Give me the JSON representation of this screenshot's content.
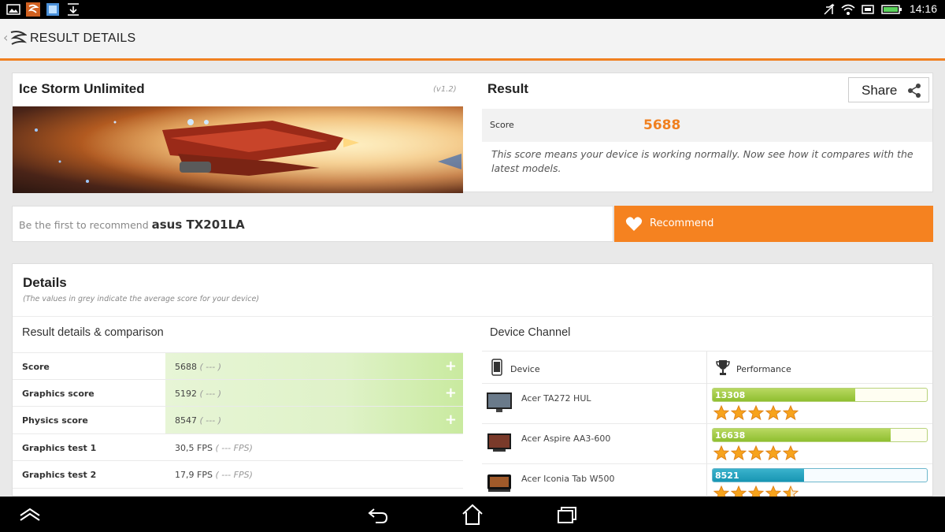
{
  "status_bar": {
    "time": "14:16",
    "left_icons": [
      "gallery-icon",
      "app-icon",
      "screenshot-icon",
      "download-icon"
    ],
    "right_icons": [
      "mute-icon",
      "wifi-icon",
      "cast-icon",
      "battery-icon"
    ],
    "colors": {
      "background": "#000000",
      "text": "#ffffff"
    }
  },
  "app_bar": {
    "title": "RESULT DETAILS",
    "back_icon": "chevron-left-icon",
    "logo_icon": "futuremark-logo-icon",
    "accent": "#f08020"
  },
  "benchmark": {
    "test_name": "Ice Storm Unlimited",
    "version": "(v1.2)",
    "banner": "spaceship-banner-image"
  },
  "result": {
    "title": "Result",
    "share_label": "Share",
    "share_icon": "share-icon",
    "score_label": "Score",
    "score_value": "5688",
    "message": "This score means your device is working normally. Now see how it compares with the latest models.",
    "score_color": "#f08020"
  },
  "recommend": {
    "prompt": "Be the first to recommend",
    "device": "asus TX201LA",
    "button_label": "Recommend",
    "button_icon": "heart-icon",
    "button_color": "#f58220"
  },
  "details": {
    "title": "Details",
    "note": "(The values in grey indicate the average score for your device)",
    "result_section_title": "Result details & comparison",
    "rows": [
      {
        "label": "Score",
        "value": "5688",
        "average": "( --- )",
        "highlight": true
      },
      {
        "label": "Graphics score",
        "value": "5192",
        "average": "( --- )",
        "highlight": true
      },
      {
        "label": "Physics score",
        "value": "8547",
        "average": "( --- )",
        "highlight": true
      },
      {
        "label": "Graphics test 1",
        "value": "30,5 FPS",
        "average": "( --- FPS)",
        "highlight": false
      },
      {
        "label": "Graphics test 2",
        "value": "17,9 FPS",
        "average": "( --- FPS)",
        "highlight": false
      }
    ]
  },
  "device_channel": {
    "title": "Device Channel",
    "col_device": "Device",
    "col_performance": "Performance",
    "max_score": 20000,
    "devices": [
      {
        "name": "Acer TA272 HUL",
        "score": "13308",
        "score_num": 13308,
        "stars": 5,
        "bar_color": "green"
      },
      {
        "name": "Acer Aspire AA3-600",
        "score": "16638",
        "score_num": 16638,
        "stars": 5,
        "bar_color": "green"
      },
      {
        "name": "Acer Iconia Tab W500",
        "score": "8521",
        "score_num": 8521,
        "stars": 4.5,
        "bar_color": "blue"
      }
    ]
  },
  "nav_bar": {
    "buttons": [
      "home-up-icon",
      "back-icon",
      "home-icon",
      "recents-icon"
    ]
  }
}
